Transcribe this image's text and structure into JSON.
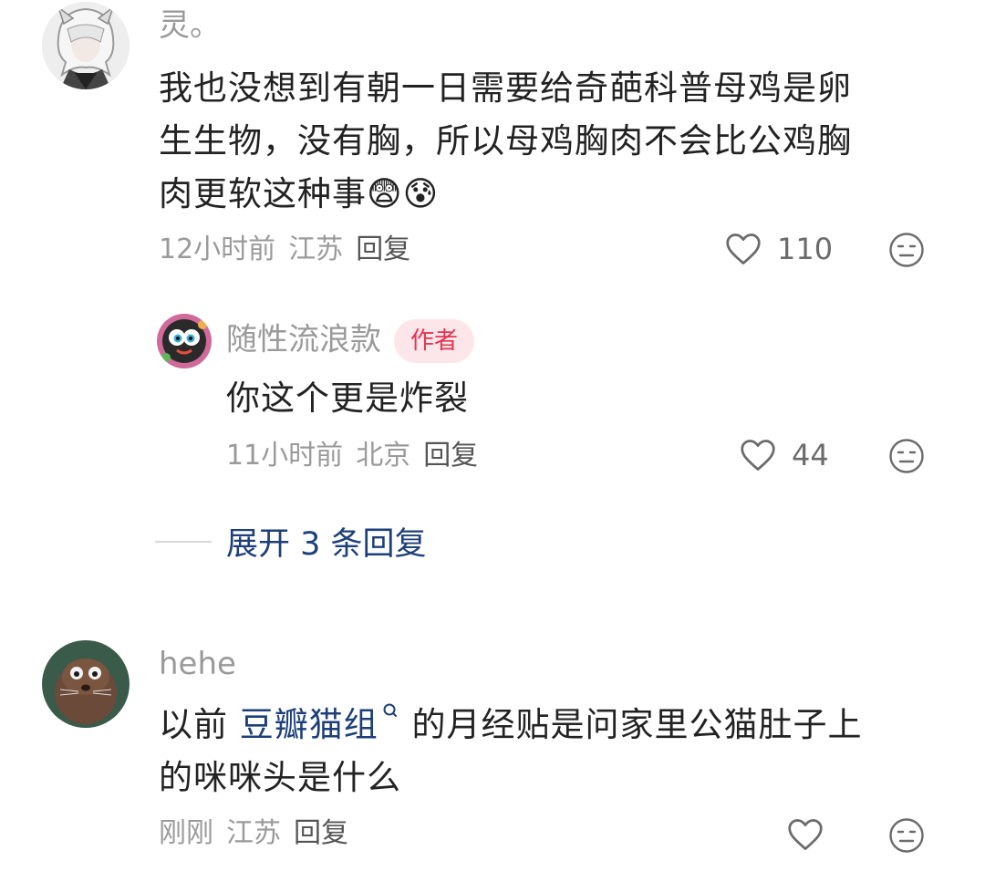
{
  "comments": [
    {
      "username": "灵。",
      "content_lines": [
        "我也没想到有朝一日需要给奇葩科普母鸡是卵",
        "生生物，没有胸，所以母鸡胸肉不会比公鸡胸",
        "肉更软这种事"
      ],
      "emojis": [
        "😨",
        "😰"
      ],
      "time": "12小时前",
      "location": "江苏",
      "reply_label": "回复",
      "likes": "110",
      "avatar_desc": "white-haired anime character",
      "replies": [
        {
          "username": "随性流浪款",
          "badge": "作者",
          "content": "你这个更是炸裂",
          "time": "11小时前",
          "location": "北京",
          "reply_label": "回复",
          "likes": "44"
        }
      ],
      "expand_label": "展开 3 条回复"
    },
    {
      "username": "hehe",
      "content_prefix": "以前",
      "topic_link": "豆瓣猫组",
      "content_suffix": "的月经贴是问家里公猫肚子上",
      "content_line2": "的咪咪头是什么",
      "time": "刚刚",
      "location": "江苏",
      "reply_label": "回复",
      "likes": ""
    }
  ],
  "colors": {
    "meta_gray": "#9a9a9a",
    "link_blue": "#1d3f7a",
    "badge_bg": "#fde6ea",
    "badge_text": "#e3344f"
  }
}
